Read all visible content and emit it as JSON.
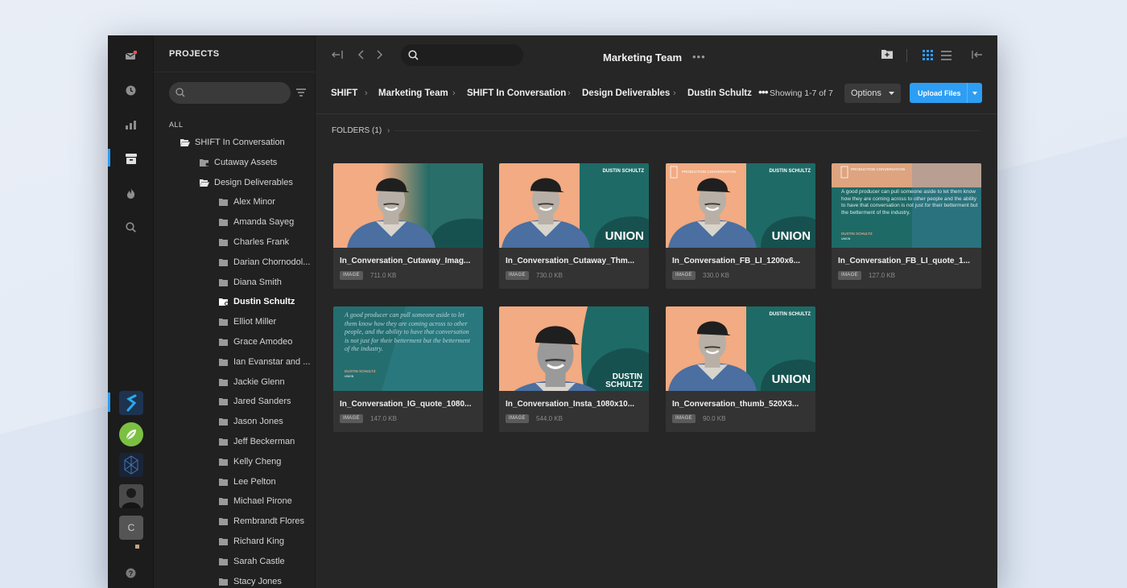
{
  "window": {
    "panel_title": "PROJECTS",
    "tree_all_label": "ALL",
    "main_title": "Marketing Team",
    "main_more": "•••"
  },
  "rail": {
    "icons": [
      "mail-icon",
      "clock-icon",
      "chart-icon",
      "archive-icon",
      "fire-icon",
      "search-icon",
      "help-icon"
    ],
    "avatars": [
      "S",
      "",
      "",
      "",
      "C"
    ],
    "notification_color": "#e8514f"
  },
  "tree": {
    "items": [
      {
        "label": "SHIFT In Conversation",
        "level": 0,
        "open": true
      },
      {
        "label": "Cutaway Assets",
        "level": 1,
        "open": false
      },
      {
        "label": "Design Deliverables",
        "level": 1,
        "open": true
      },
      {
        "label": "Alex Minor",
        "level": 2
      },
      {
        "label": "Amanda Sayeg",
        "level": 2
      },
      {
        "label": "Charles Frank",
        "level": 2
      },
      {
        "label": "Darian Chornodol...",
        "level": 2
      },
      {
        "label": "Diana Smith",
        "level": 2
      },
      {
        "label": "Dustin Schultz",
        "level": 2,
        "active": true
      },
      {
        "label": "Elliot Miller",
        "level": 2
      },
      {
        "label": "Grace Amodeo",
        "level": 2
      },
      {
        "label": "Ian Evanstar and ...",
        "level": 2
      },
      {
        "label": "Jackie Glenn",
        "level": 2
      },
      {
        "label": "Jared Sanders",
        "level": 2
      },
      {
        "label": "Jason Jones",
        "level": 2
      },
      {
        "label": "Jeff Beckerman",
        "level": 2
      },
      {
        "label": "Kelly Cheng",
        "level": 2
      },
      {
        "label": "Lee Pelton",
        "level": 2
      },
      {
        "label": "Michael Pirone",
        "level": 2
      },
      {
        "label": "Rembrandt Flores",
        "level": 2
      },
      {
        "label": "Richard King",
        "level": 2
      },
      {
        "label": "Sarah Castle",
        "level": 2
      },
      {
        "label": "Stacy Jones",
        "level": 2
      }
    ]
  },
  "breadcrumb": [
    "SHIFT",
    "Marketing Team",
    "SHIFT In Conversation",
    "Design Deliverables",
    "Dustin Schultz"
  ],
  "breadcrumb_more": "•••",
  "showing": "Showing 1-7 of 7",
  "options_label": "Options",
  "upload_label": "Upload Files",
  "folders_label": "FOLDERS (1)",
  "files": [
    {
      "name": "In_Conversation_Cutaway_Imag...",
      "type": "IMAGE",
      "size": "711.0 KB",
      "thumb": "photo-plain"
    },
    {
      "name": "In_Conversation_Cutaway_Thm...",
      "type": "IMAGE",
      "size": "730.0 KB",
      "thumb": "photo-union"
    },
    {
      "name": "In_Conversation_FB_LI_1200x6...",
      "type": "IMAGE",
      "size": "330.0 KB",
      "thumb": "photo-union-2"
    },
    {
      "name": "In_Conversation_FB_LI_quote_1...",
      "type": "IMAGE",
      "size": "127.0 KB",
      "thumb": "quote-wide"
    },
    {
      "name": "In_Conversation_IG_quote_1080...",
      "type": "IMAGE",
      "size": "147.0 KB",
      "thumb": "quote-square"
    },
    {
      "name": "In_Conversation_Insta_1080x10...",
      "type": "IMAGE",
      "size": "544.0 KB",
      "thumb": "photo-insta"
    },
    {
      "name": "In_Conversation_thumb_520X3...",
      "type": "IMAGE",
      "size": "90.0 KB",
      "thumb": "photo-union-3"
    }
  ],
  "thumb_text": {
    "dustin_schultz": "DUSTIN SCHULTZ",
    "dustin": "DUSTIN",
    "schultz": "SCHULTZ",
    "union": "UNION",
    "production_conversation": "PRODUCTION CONVERSATION",
    "quote_wide": "A good producer can pull someone aside to let them know how they are coming across to other people and the ability to have that conversation is not just for their betterment but the betterment of the industry.",
    "quote_square": "A good producer can pull someone aside to let them know how they are coming across to other people, and the ability to have that conversation is not just for their betterment but the betterment of the industry.",
    "union_small": "UNION"
  },
  "colors": {
    "accent": "#2d9ef4",
    "peach": "#f2ab82",
    "teal": "#1e6a66",
    "teal_dark": "#17514f"
  }
}
